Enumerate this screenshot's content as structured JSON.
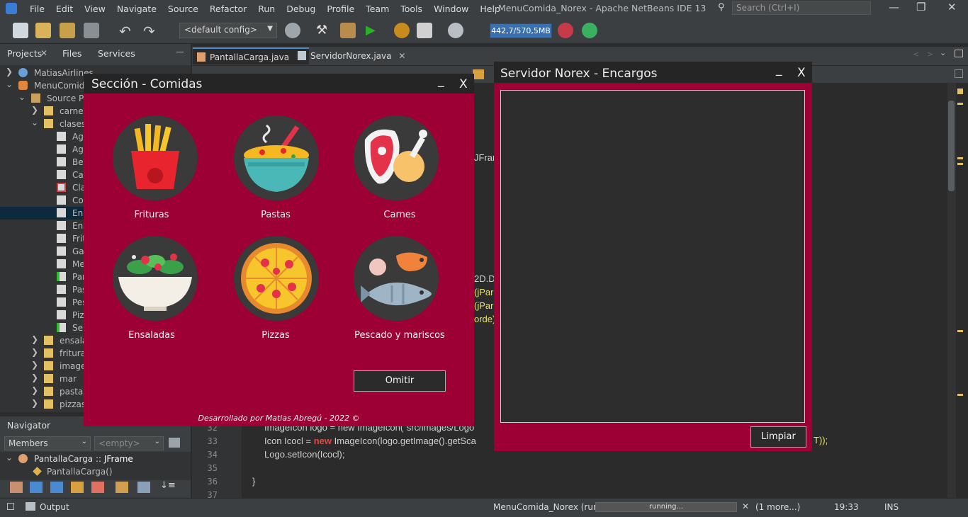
{
  "ide": {
    "menu": [
      "File",
      "Edit",
      "View",
      "Navigate",
      "Source",
      "Refactor",
      "Run",
      "Debug",
      "Profile",
      "Team",
      "Tools",
      "Window",
      "Help"
    ],
    "window_title": "MenuComida_Norex - Apache NetBeans IDE 13",
    "search_placeholder": "Search (Ctrl+I)",
    "config": "<default config>",
    "memory": "442,7/570,5MB"
  },
  "projects_panel": {
    "tabs": [
      "Projects",
      "Files",
      "Services"
    ],
    "tree": [
      {
        "label": "MatiasAirlines"
      },
      {
        "label": "MenuComida"
      },
      {
        "label": "Source Pa"
      },
      {
        "label": "carnes"
      },
      {
        "label": "clases"
      },
      {
        "label": "Agu"
      },
      {
        "label": "Agu"
      },
      {
        "label": "Beb"
      },
      {
        "label": "Car"
      },
      {
        "label": "Cla"
      },
      {
        "label": "Con"
      },
      {
        "label": "Enc"
      },
      {
        "label": "Ens"
      },
      {
        "label": "Frit"
      },
      {
        "label": "Gas"
      },
      {
        "label": "Mer"
      },
      {
        "label": "Par"
      },
      {
        "label": "Pas"
      },
      {
        "label": "Pes"
      },
      {
        "label": "Pizz"
      },
      {
        "label": "Ser"
      },
      {
        "label": "ensalad"
      },
      {
        "label": "frituras"
      },
      {
        "label": "images"
      },
      {
        "label": "mar"
      },
      {
        "label": "pastasl"
      },
      {
        "label": "pizzasl"
      }
    ]
  },
  "navigator": {
    "title": "Navigator",
    "members": "Members",
    "filter": "<empty>",
    "class_name": "PantallaCarga",
    "class_sep": " :: ",
    "class_super": "JFrame",
    "constructor": "PantallaCarga()"
  },
  "editor": {
    "tabs": [
      "PantallaCarga.java",
      "ServidorNorex.java"
    ],
    "fragments": {
      "f1": "JFran",
      "f2": "2D.D",
      "f3": "(jPar",
      "f4": "(jPar",
      "f5": "orde)",
      "f6": "T));"
    },
    "lines": [
      {
        "num": "32",
        "code": "ImageIcon logo = new ImageIcon(\"src/images/Logo"
      },
      {
        "num": "33",
        "code_a": "Icon Icocl = ",
        "kw": "new",
        "code_b": " ImageIcon(logo.getImage().getSca"
      },
      {
        "num": "34",
        "code": "Logo.setIcon(Icocl);"
      },
      {
        "num": "35",
        "code": ""
      },
      {
        "num": "36",
        "code": "}"
      },
      {
        "num": "37",
        "code": ""
      }
    ]
  },
  "statusbar": {
    "output": "Output",
    "run_task": "MenuComida_Norex (run)",
    "progress": "running...",
    "more": "(1 more...)",
    "time": "19:33",
    "mode": "INS"
  },
  "seccion": {
    "title": "Sección - Comidas",
    "min": "_",
    "close": "X",
    "items": [
      {
        "label": "Frituras"
      },
      {
        "label": "Pastas"
      },
      {
        "label": "Carnes"
      },
      {
        "label": "Ensaladas"
      },
      {
        "label": "Pizzas"
      },
      {
        "label": "Pescado y mariscos"
      }
    ],
    "omitir": "Omitir",
    "footer": "Desarrollado por Matias Abregú - 2022 ©"
  },
  "servidor": {
    "title": "Servidor Norex - Encargos",
    "min": "_",
    "close": "X",
    "limpiar": "Limpiar"
  },
  "colors": {
    "accent": "#9c0034",
    "titlebar": "#252526",
    "ide_bg": "#2b2b2b"
  }
}
